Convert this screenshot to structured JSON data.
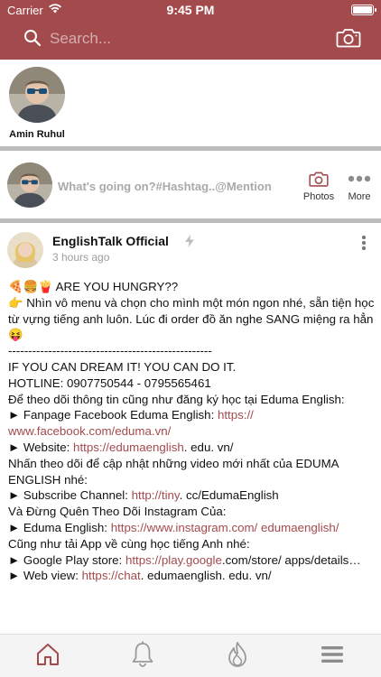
{
  "status_bar": {
    "carrier": "Carrier",
    "time": "9:45 PM"
  },
  "header": {
    "background": "#a34a4d",
    "search_placeholder": "Search...",
    "search_icon": "search-icon",
    "camera_icon": "camera-icon"
  },
  "stories": [
    {
      "name": "Amin Ruhul",
      "avatar": "user-avatar"
    }
  ],
  "composer": {
    "prompt": "What's going on?#Hashtag..@Mention",
    "photos_label": "Photos",
    "more_label": "More"
  },
  "post": {
    "author": "EnglishTalk Official",
    "verified_icon": "bolt-icon",
    "time": "3 hours ago",
    "body": [
      "🍕🍔🍟 ARE YOU HUNGRY??",
      "👉 Nhìn vô menu và chọn cho mình một món ngon nhé, sẵn tiện học từ vựng tiếng anh luôn. Lúc đi order đồ ăn nghe SANG miệng ra hẳn 😝",
      "---------------------------------------------------",
      "IF YOU CAN DREAM IT! YOU CAN DO IT.",
      "HOTLINE: 0907750544 - 0795565461",
      "Để theo dõi thông tin cũng như đăng ký học tại Eduma English:"
    ],
    "links": {
      "fanpage_prefix": "► Fanpage Facebook Eduma English: ",
      "fanpage_link": "https:// www.facebook.com/eduma.vn/",
      "website_prefix": "► Website: ",
      "website_link": "https://edumaenglish",
      "website_suffix": ". edu. vn/",
      "video_intro": "Nhấn theo dõi để cập nhật những video mới nhất của EDUMA ENGLISH nhé:",
      "subscribe_prefix": "► Subscribe Channel: ",
      "subscribe_link": "http://tiny",
      "subscribe_suffix": ". cc/EdumaEnglish",
      "instagram_intro": "Và Đừng Quên Theo Dõi Instagram Của:",
      "instagram_prefix": "► Eduma English: ",
      "instagram_link": "https://www.instagram.com/ edumaenglish/",
      "app_intro": "Cũng như tải App về cùng học tiếng Anh nhé:",
      "play_prefix": "► Google Play store: ",
      "play_link": "https://play.google",
      "play_suffix": ".com/store/ apps/details…",
      "web_prefix": "► Web view: ",
      "web_link": "https://chat",
      "web_suffix": ". edumaenglish. edu. vn/"
    }
  },
  "tabbar": {
    "items": [
      "home-icon",
      "bell-icon",
      "flame-icon",
      "menu-icon"
    ],
    "active_color": "#a34a4d"
  }
}
